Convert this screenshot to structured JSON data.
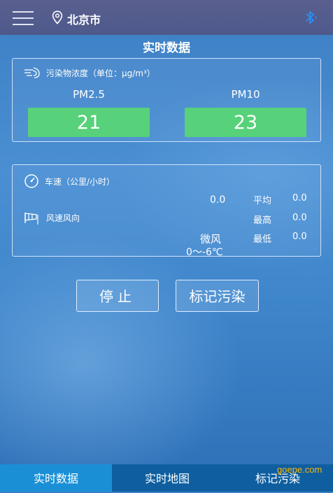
{
  "header": {
    "city": "北京市",
    "icons": {
      "menu": "hamburger-menu-icon",
      "location": "location-pin-icon",
      "bluetooth": "bluetooth-icon"
    }
  },
  "page_title": "实时数据",
  "pm_panel": {
    "heading": "污染物浓度（单位：μg/m³）",
    "pm25": {
      "label": "PM2.5",
      "value": "21"
    },
    "pm10": {
      "label": "PM10",
      "value": "23"
    },
    "value_box_color": "#57d17a"
  },
  "speed_panel": {
    "speed_heading": "车速（公里/小时）",
    "current_speed": "0.0",
    "stats": [
      {
        "label": "平均",
        "value": "0.0"
      },
      {
        "label": "最高",
        "value": "0.0"
      },
      {
        "label": "最低",
        "value": "0.0"
      }
    ],
    "wind_heading": "风速风向",
    "wind_level": "微风",
    "temperature": "0～-6℃"
  },
  "buttons": {
    "stop": "停止",
    "mark": "标记污染"
  },
  "tabs": [
    {
      "label": "实时数据",
      "active": true
    },
    {
      "label": "实时地图",
      "active": false
    },
    {
      "label": "标记污染",
      "active": false
    }
  ],
  "watermark": "goepe.com",
  "colors": {
    "active_tab": "#1b8fd6",
    "tabbar": "#0f5fa0",
    "topbar": "#525c8d"
  }
}
